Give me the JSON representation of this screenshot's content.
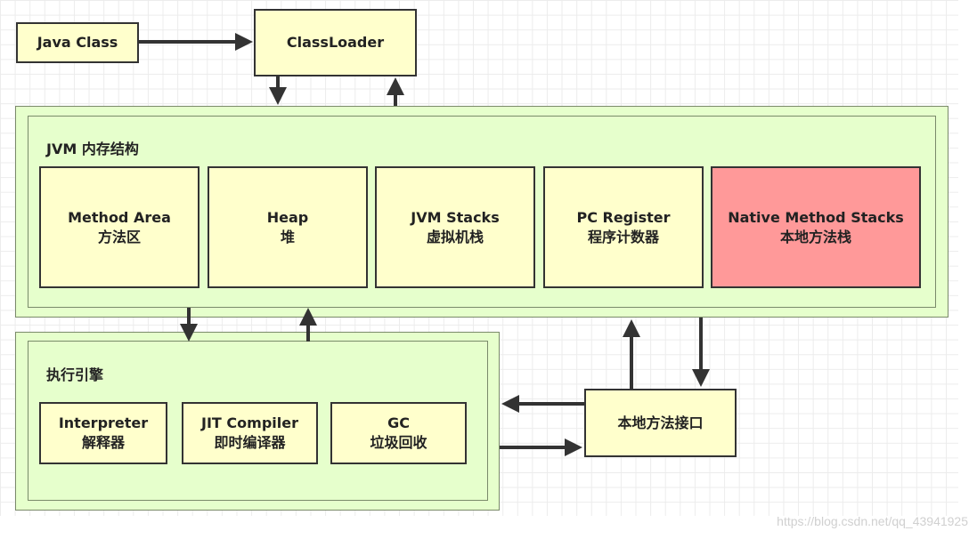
{
  "java_class": "Java Class",
  "classloader": "ClassLoader",
  "jvm_memory": {
    "title": "JVM 内存结构",
    "areas": [
      {
        "en": "Method Area",
        "zh": "方法区"
      },
      {
        "en": "Heap",
        "zh": "堆"
      },
      {
        "en": "JVM Stacks",
        "zh": "虚拟机栈"
      },
      {
        "en": "PC Register",
        "zh": "程序计数器"
      },
      {
        "en": "Native Method Stacks",
        "zh": "本地方法栈"
      }
    ]
  },
  "execution_engine": {
    "title": "执行引擎",
    "parts": [
      {
        "en": "Interpreter",
        "zh": "解释器"
      },
      {
        "en": "JIT Compiler",
        "zh": "即时编译器"
      },
      {
        "en": "GC",
        "zh": "垃圾回收"
      }
    ]
  },
  "native_interface": "本地方法接口",
  "watermark": "https://blog.csdn.net/qq_43941925",
  "colors": {
    "box": "#ffffcc",
    "container": "#e6ffcc",
    "native_stack": "#ff9999"
  }
}
